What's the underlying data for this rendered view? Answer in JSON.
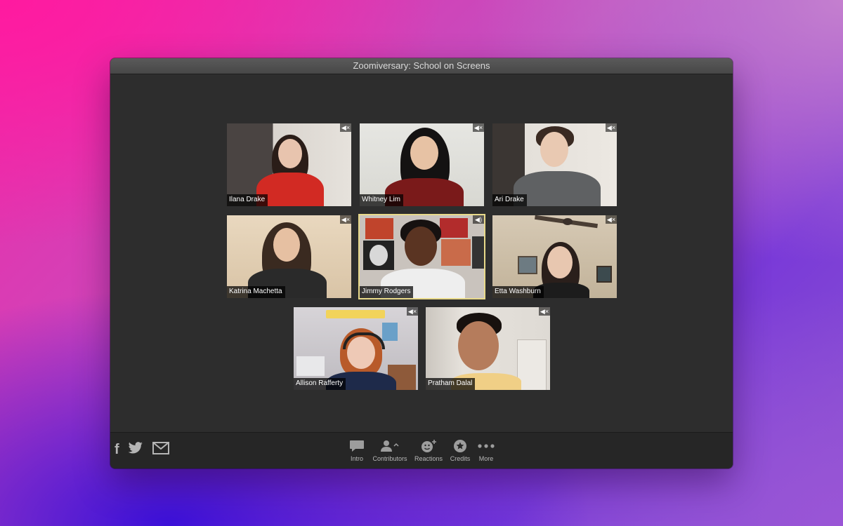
{
  "window": {
    "title": "Zoomiversary: School on Screens"
  },
  "participants": [
    {
      "name": "Ilana Drake",
      "audio": "muted"
    },
    {
      "name": "Whitney Lim",
      "audio": "muted"
    },
    {
      "name": "Ari Drake",
      "audio": "muted"
    },
    {
      "name": "Katrina Machetta",
      "audio": "muted"
    },
    {
      "name": "Jimmy Rodgers",
      "audio": "speaking"
    },
    {
      "name": "Etta Washburn",
      "audio": "muted"
    },
    {
      "name": "Allison Rafferty",
      "audio": "muted"
    },
    {
      "name": "Pratham Dalal",
      "audio": "muted"
    }
  ],
  "icons": {
    "muted": "speaker-muted-icon",
    "speaking": "speaker-on-icon"
  },
  "social": [
    "facebook-icon",
    "twitter-icon",
    "mail-icon"
  ],
  "toolbar": {
    "intro_label": "Intro",
    "contributors_label": "Contributors",
    "reactions_label": "Reactions",
    "credits_label": "Credits",
    "more_label": "More"
  },
  "colors": {
    "active_speaker_border": "#e8d98a",
    "window_bg": "#2d2d2d"
  }
}
